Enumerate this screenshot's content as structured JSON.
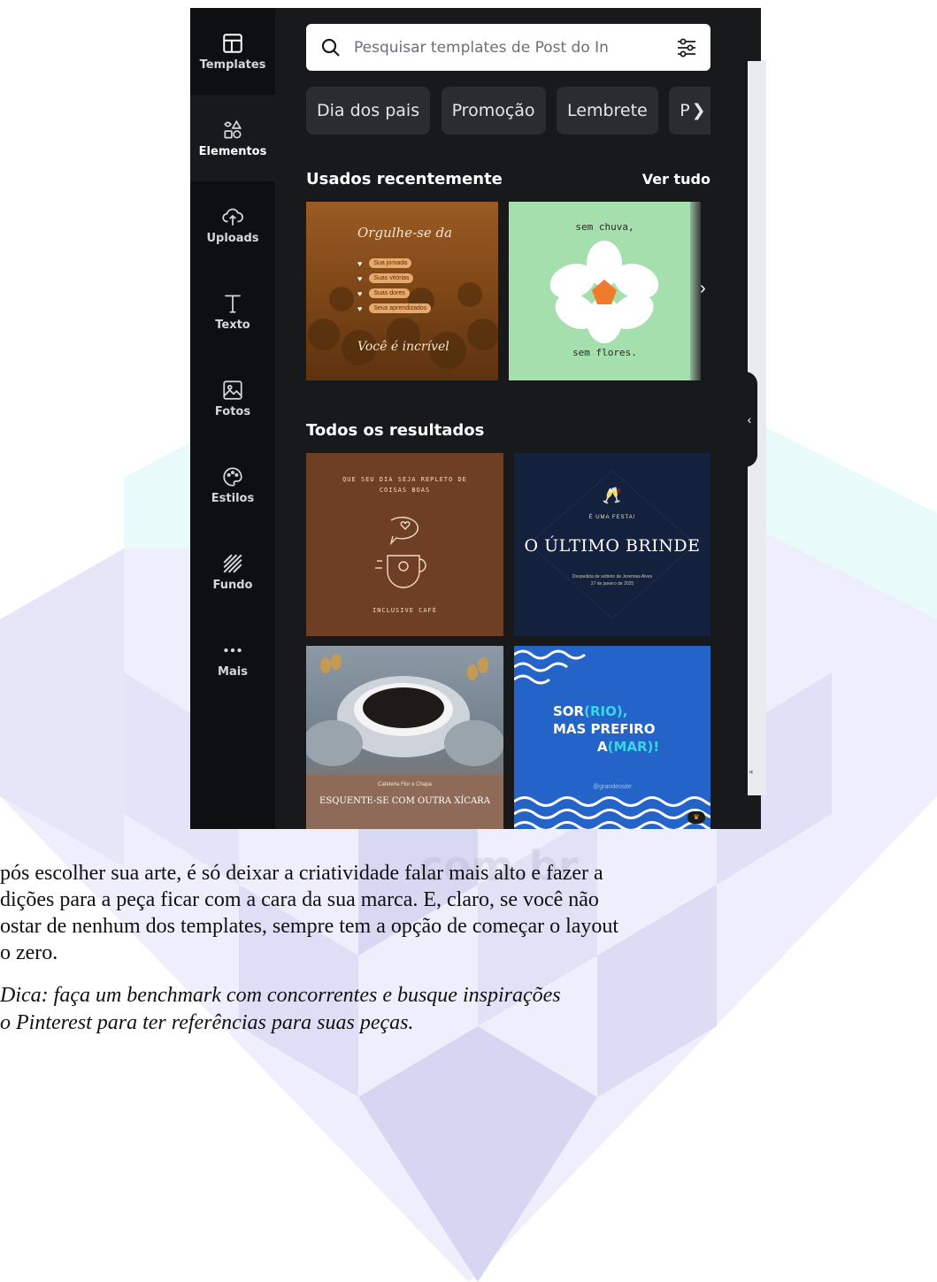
{
  "sidebar": {
    "items": [
      {
        "label": "Templates",
        "icon": "templates-icon"
      },
      {
        "label": "Elementos",
        "icon": "shapes-icon"
      },
      {
        "label": "Uploads",
        "icon": "cloud-upload-icon"
      },
      {
        "label": "Texto",
        "icon": "text-icon"
      },
      {
        "label": "Fotos",
        "icon": "image-icon"
      },
      {
        "label": "Estilos",
        "icon": "palette-icon"
      },
      {
        "label": "Fundo",
        "icon": "background-icon"
      },
      {
        "label": "Mais",
        "icon": "more-icon"
      }
    ]
  },
  "search": {
    "placeholder": "Pesquisar templates de Post do In"
  },
  "chips": [
    "Dia dos pais",
    "Promoção",
    "Lembrete",
    "P"
  ],
  "recent": {
    "title": "Usados recentemente",
    "see_all": "Ver tudo",
    "cards": [
      {
        "title": "Orgulhe-se da",
        "bullets": [
          "Sua jornada",
          "Suas vitórias",
          "Suas dores",
          "Seus aprendizados"
        ],
        "footer": "Você é incrível"
      },
      {
        "top": "sem chuva,",
        "bottom": "sem flores."
      }
    ]
  },
  "results": {
    "title": "Todos os resultados",
    "cards": [
      {
        "top": "QUE SEU DIA SEJA REPLETO DE\nCOISAS BOAS",
        "bottom": "INCLUSIVE CAFÉ"
      },
      {
        "kicker": "É UMA FESTA!",
        "title": "O ÚLTIMO BRINDE",
        "sub": "Despedida de solteiro de Jeremias Alves\n27 de janeiro de 2025"
      },
      {
        "brand": "Cafeteria Flor e Chapa",
        "title": "ESQUENTE-SE COM OUTRA XÍCARA"
      },
      {
        "line1": "SOR",
        "line1_accent": "(RIO),",
        "line2": "MAS PREFIRO",
        "line3": "A",
        "line3_accent": "(MAR)!",
        "handle": "@grandeosite"
      }
    ]
  },
  "watermark": ".com.br",
  "article": {
    "paragraph": "pós escolher sua arte, é só deixar a criatividade falar mais alto e fazer a\ndições para a peça ficar com a cara da sua marca. E, claro, se você não\nostar de nenhum dos templates, sempre tem a opção de começar o layout\no zero.",
    "tip": "Dica: faça um benchmark com concorrentes e busque inspirações\no Pinterest para ter referências para suas peças."
  },
  "colors": {
    "panel_bg": "#18191b",
    "rail_bg": "#0e0f11",
    "chip_bg": "#2b2c30",
    "watermark": "#dcdcf5"
  }
}
